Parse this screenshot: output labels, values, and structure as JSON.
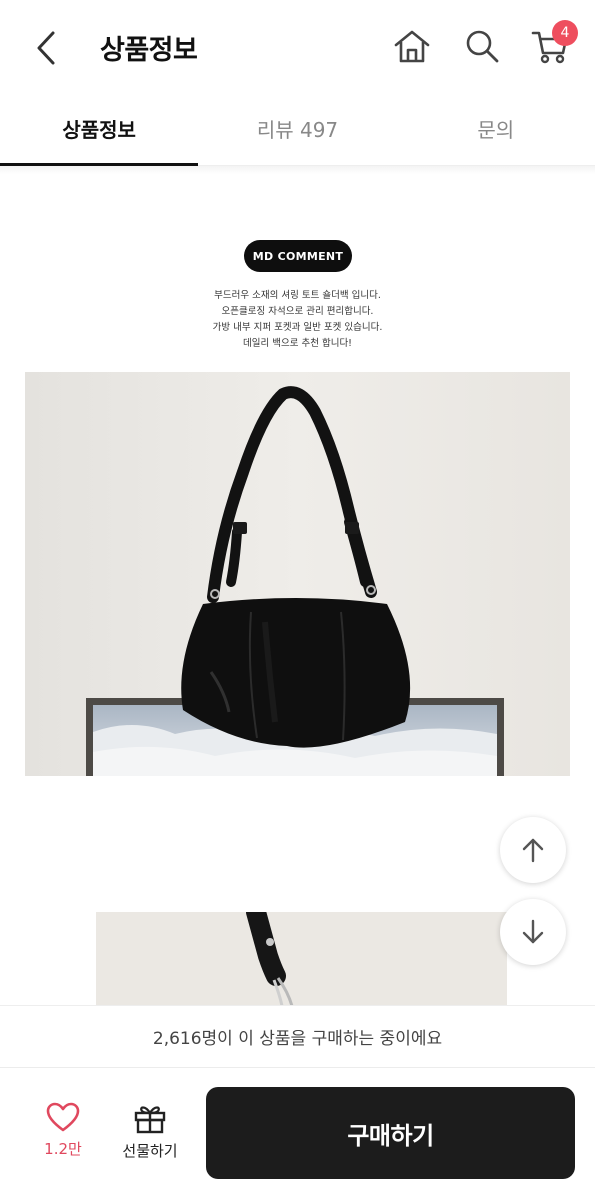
{
  "header": {
    "title": "상품정보",
    "cart_count": "4",
    "icons": [
      "back-arrow-icon",
      "home-icon",
      "search-icon",
      "cart-icon"
    ]
  },
  "tabs": [
    {
      "label": "상품정보",
      "active": true
    },
    {
      "label": "리뷰 497",
      "active": false
    },
    {
      "label": "문의",
      "active": false
    }
  ],
  "content": {
    "badge": "MD COMMENT",
    "lines": [
      "부드러우 소재의 셔링 토트 숄더백 입니다.",
      "오픈클로징 자석으로 관리 편리합니다.",
      "가방 내부 지퍼 포켓과 일반 포켓 있습니다.",
      "데일리 백으로 추천 합니다!"
    ]
  },
  "buying_notice": "2,616명이 이 상품을 구매하는 중이에요",
  "bottom_bar": {
    "like_count": "1.2만",
    "gift_label": "선물하기",
    "buy_label": "구매하기"
  },
  "colors": {
    "accent": "#ee4e5e",
    "like": "#e0485e",
    "buy_button": "#1c1c1c"
  }
}
